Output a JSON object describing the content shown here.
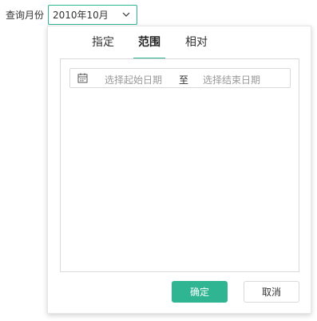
{
  "query": {
    "label": "查询月份",
    "selected_month": "2010年10月",
    "icon": "chevron-down-icon"
  },
  "panel": {
    "tabs": [
      {
        "label": "指定",
        "active": false
      },
      {
        "label": "范围",
        "active": true
      },
      {
        "label": "相对",
        "active": false
      }
    ],
    "range": {
      "calendar_icon": "calendar-icon",
      "start_placeholder": "选择起始日期",
      "separator": "至",
      "end_placeholder": "选择结束日期"
    },
    "buttons": {
      "ok_label": "确定",
      "cancel_label": "取消"
    }
  },
  "colors": {
    "accent": "#2fb592",
    "border": "#d9d9d9",
    "placeholder": "#999999",
    "text": "#333333"
  }
}
